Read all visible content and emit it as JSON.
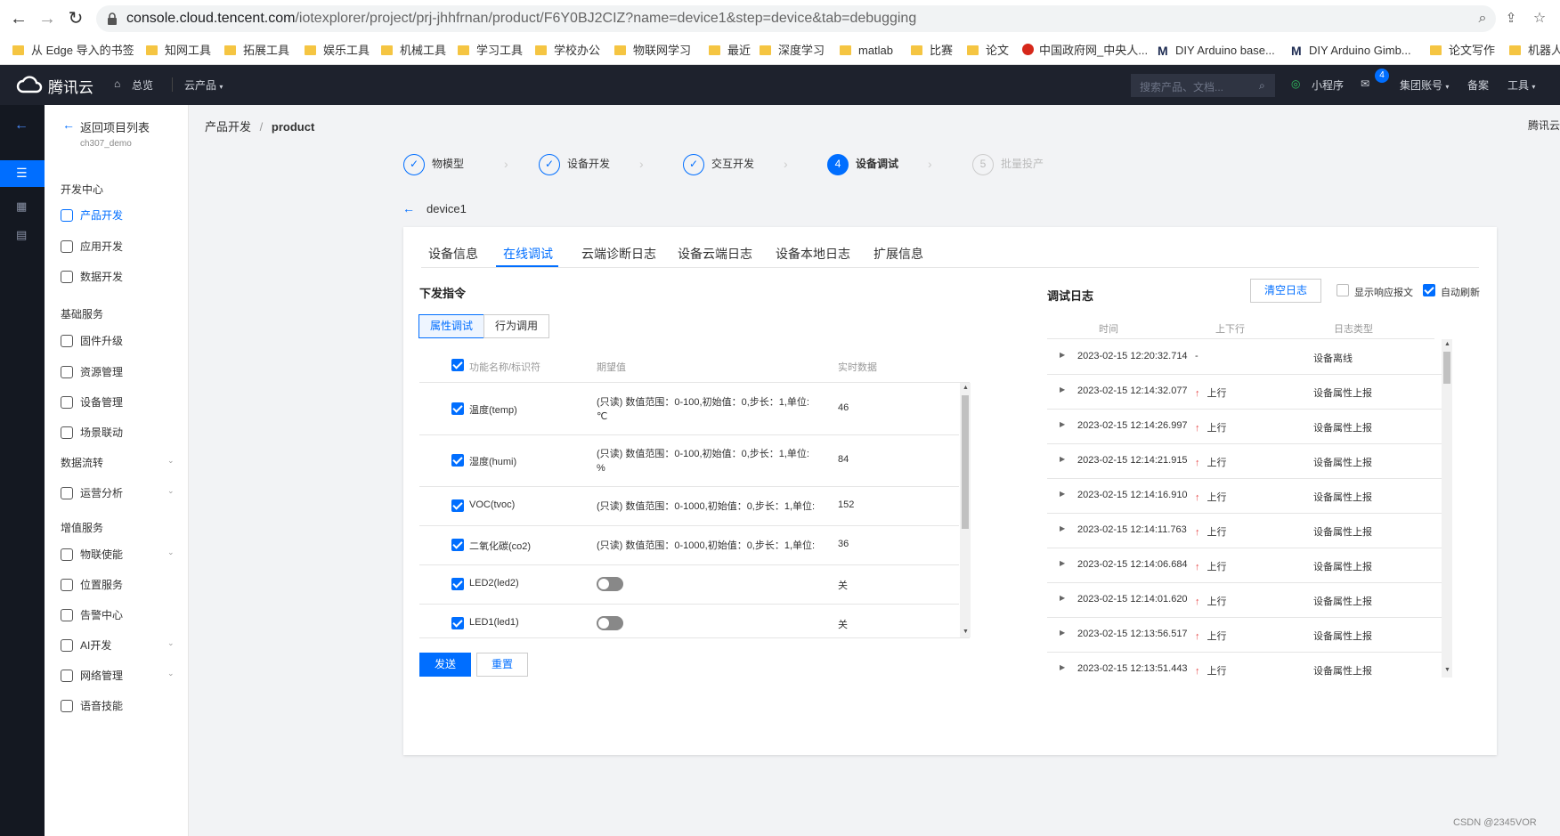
{
  "browser": {
    "url_host": "console.cloud.tencent.com",
    "url_path": "/iotexplorer/project/prj-jhhfrnan/product/F6Y0BJ2CIZ?name=device1&step=device&tab=debugging",
    "bookmarks": [
      "从 Edge 导入的书签",
      "知网工具",
      "拓展工具",
      "娱乐工具",
      "机械工具",
      "学习工具",
      "学校办公",
      "物联网学习",
      "最近",
      "深度学习",
      "matlab",
      "比赛",
      "论文",
      "中国政府网_中央人...",
      "DIY Arduino base...",
      "DIY Arduino Gimb...",
      "论文写作",
      "机器人"
    ]
  },
  "topbar": {
    "brand": "腾讯云",
    "overview": "总览",
    "products": "云产品",
    "search_placeholder": "搜索产品、文档...",
    "mini_program": "小程序",
    "mail_count": "4",
    "account": "集团账号",
    "beian": "备案",
    "tools": "工具"
  },
  "sidenav": {
    "back": "返回项目列表",
    "project": "ch307_demo",
    "sections": [
      {
        "title": "开发中心",
        "items": [
          "产品开发",
          "应用开发",
          "数据开发"
        ]
      },
      {
        "title": "基础服务",
        "items": [
          "固件升级",
          "资源管理",
          "设备管理",
          "场景联动"
        ]
      },
      {
        "title": "",
        "items": [
          "数据流转",
          "运营分析"
        ]
      },
      {
        "title": "增值服务",
        "items": [
          "物联使能",
          "位置服务",
          "告警中心",
          "AI开发",
          "网络管理",
          "语音技能"
        ]
      }
    ]
  },
  "breadcrumb": {
    "parent": "产品开发",
    "sep": "/",
    "current": "product",
    "right": "腾讯云"
  },
  "steps": [
    {
      "label": "物模型",
      "num": "✓",
      "state": "done"
    },
    {
      "label": "设备开发",
      "num": "✓",
      "state": "done"
    },
    {
      "label": "交互开发",
      "num": "✓",
      "state": "done"
    },
    {
      "label": "设备调试",
      "num": "4",
      "state": "active"
    },
    {
      "label": "批量投产",
      "num": "5",
      "state": "disabled"
    }
  ],
  "device_name": "device1",
  "tabs": [
    "设备信息",
    "在线调试",
    "云端诊断日志",
    "设备云端日志",
    "设备本地日志",
    "扩展信息"
  ],
  "commands": {
    "title": "下发指令",
    "subtabs": [
      "属性调试",
      "行为调用"
    ],
    "columns": [
      "功能名称/标识符",
      "期望值",
      "实时数据"
    ],
    "rows": [
      {
        "name": "温度(temp)",
        "desc1": "(只读) 数值范围：0-100,初始值：0,步长：1,单位:",
        "desc2": "℃",
        "value": "46"
      },
      {
        "name": "湿度(humi)",
        "desc1": "(只读) 数值范围：0-100,初始值：0,步长：1,单位:",
        "desc2": "%",
        "value": "84"
      },
      {
        "name": "VOC(tvoc)",
        "desc1": "(只读) 数值范围：0-1000,初始值：0,步长：1,单位:",
        "desc2": "",
        "value": "152"
      },
      {
        "name": "二氧化碳(co2)",
        "desc1": "(只读) 数值范围：0-1000,初始值：0,步长：1,单位:",
        "desc2": "",
        "value": "36"
      },
      {
        "name": "LED2(led2)",
        "toggle": true,
        "value": "关"
      },
      {
        "name": "LED1(led1)",
        "toggle": true,
        "value": "关"
      }
    ],
    "send": "发送",
    "reset": "重置"
  },
  "log": {
    "title": "调试日志",
    "clear": "清空日志",
    "show_response": "显示响应报文",
    "auto_refresh": "自动刷新",
    "columns": [
      "时间",
      "上下行",
      "日志类型"
    ],
    "rows": [
      {
        "time": "2023-02-15 12:20:32.714",
        "dir": "-",
        "type": "设备离线",
        "up": false
      },
      {
        "time": "2023-02-15 12:14:32.077",
        "dir": "上行",
        "type": "设备属性上报",
        "up": true
      },
      {
        "time": "2023-02-15 12:14:26.997",
        "dir": "上行",
        "type": "设备属性上报",
        "up": true
      },
      {
        "time": "2023-02-15 12:14:21.915",
        "dir": "上行",
        "type": "设备属性上报",
        "up": true
      },
      {
        "time": "2023-02-15 12:14:16.910",
        "dir": "上行",
        "type": "设备属性上报",
        "up": true
      },
      {
        "time": "2023-02-15 12:14:11.763",
        "dir": "上行",
        "type": "设备属性上报",
        "up": true
      },
      {
        "time": "2023-02-15 12:14:06.684",
        "dir": "上行",
        "type": "设备属性上报",
        "up": true
      },
      {
        "time": "2023-02-15 12:14:01.620",
        "dir": "上行",
        "type": "设备属性上报",
        "up": true
      },
      {
        "time": "2023-02-15 12:13:56.517",
        "dir": "上行",
        "type": "设备属性上报",
        "up": true
      },
      {
        "time": "2023-02-15 12:13:51.443",
        "dir": "上行",
        "type": "设备属性上报",
        "up": true
      }
    ]
  },
  "watermark": "CSDN @2345VOR",
  "colors": {
    "accent": "#006eff",
    "topbar": "#1e222d",
    "rail": "#141821",
    "up_arrow": "#e54545"
  }
}
